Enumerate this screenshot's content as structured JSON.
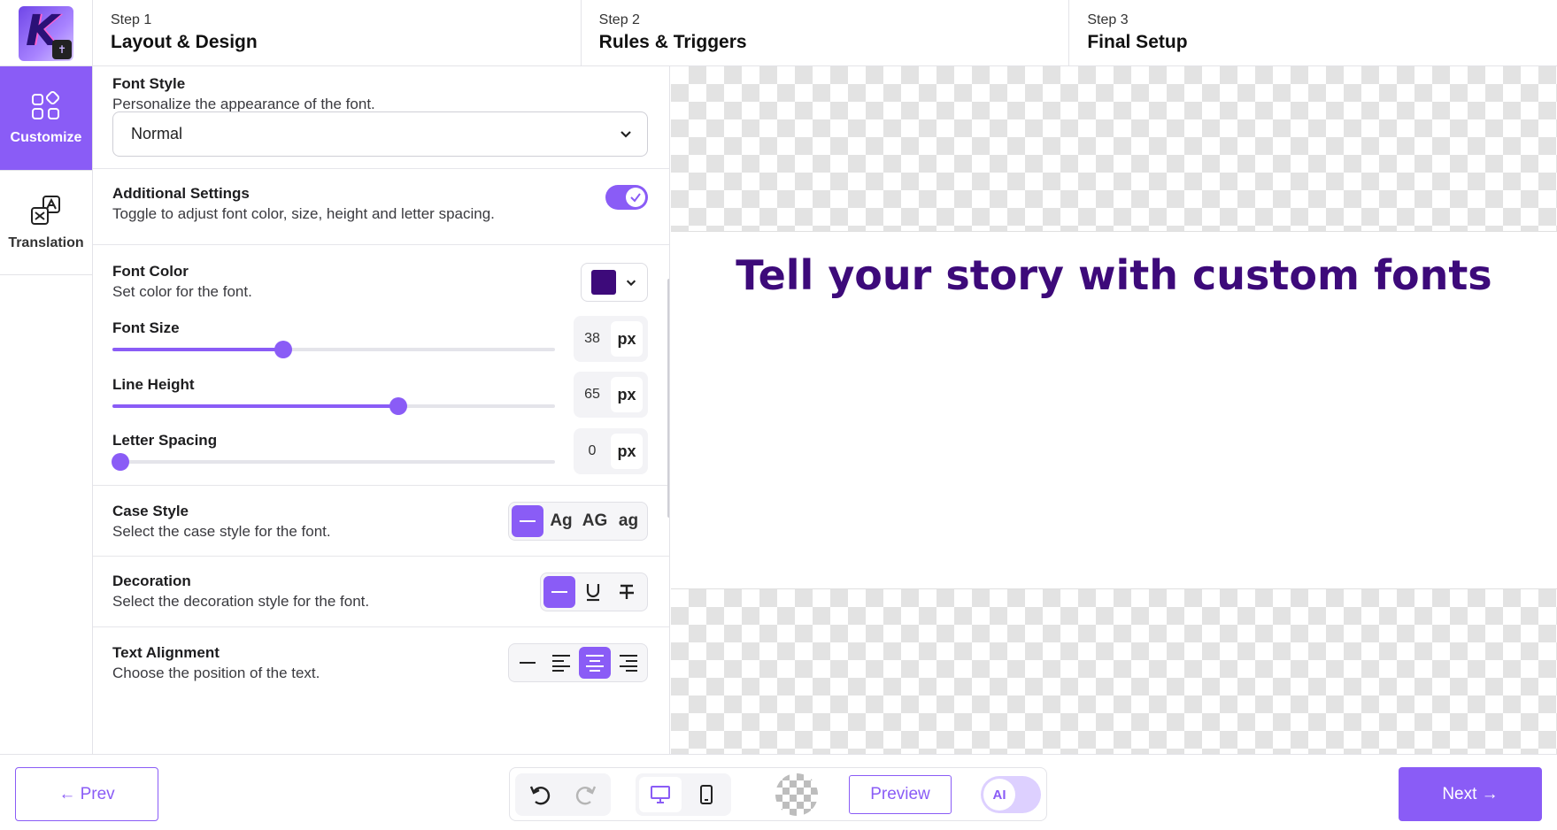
{
  "steps": [
    {
      "num": "Step 1",
      "title": "Layout & Design"
    },
    {
      "num": "Step 2",
      "title": "Rules & Triggers"
    },
    {
      "num": "Step 3",
      "title": "Final Setup"
    }
  ],
  "logo": {
    "letter": "K"
  },
  "sidenav": {
    "items": [
      {
        "label": "Customize",
        "icon": "grid-icon",
        "active": true
      },
      {
        "label": "Translation",
        "icon": "translate-icon",
        "active": false
      }
    ]
  },
  "font_style": {
    "heading": "Font Style",
    "desc": "Personalize the appearance of the font.",
    "value": "Normal"
  },
  "additional": {
    "heading": "Additional Settings",
    "desc": "Toggle to adjust font color, size, height and letter spacing.",
    "enabled": true
  },
  "font_color": {
    "heading": "Font Color",
    "desc": "Set color for the font.",
    "color": "#3d0a7a"
  },
  "sliders": [
    {
      "label": "Font Size",
      "value": "38",
      "unit": "px",
      "fraction": 0.385
    },
    {
      "label": "Line Height",
      "value": "65",
      "unit": "px",
      "fraction": 0.645
    },
    {
      "label": "Letter Spacing",
      "value": "0",
      "unit": "px",
      "fraction": 0.018
    }
  ],
  "case_style": {
    "heading": "Case Style",
    "desc": "Select the case style for the font.",
    "options": [
      "Ag",
      "AG",
      "ag"
    ]
  },
  "decoration": {
    "heading": "Decoration",
    "desc": "Select the decoration style for the font."
  },
  "alignment": {
    "heading": "Text Alignment",
    "desc": "Choose the position of the text."
  },
  "preview": {
    "headline": "Tell your story with custom fonts",
    "text_color": "#3d0a7a"
  },
  "footer": {
    "prev": "← Prev",
    "next": "Next →",
    "preview": "Preview",
    "ai": "AI"
  },
  "accent": "#8a5cf6"
}
